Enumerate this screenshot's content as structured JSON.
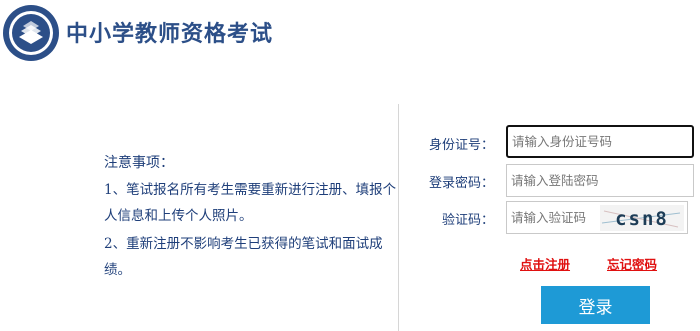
{
  "header": {
    "site_title": "中小学教师资格考试"
  },
  "notice": {
    "title": "注意事项：",
    "items": [
      "1、笔试报名所有考生需要重新进行注册、填报个人信息和上传个人照片。",
      "2、重新注册不影响考生已获得的笔试和面试成绩。"
    ]
  },
  "form": {
    "id_label": "身份证号：",
    "id_placeholder": "请输入身份证号码",
    "password_label": "登录密码：",
    "password_placeholder": "请输入登陆密码",
    "captcha_label": "验证码：",
    "captcha_placeholder": "请输入验证码",
    "captcha_text": "csn8",
    "register_link": "点击注册",
    "forgot_link": "忘记密码",
    "login_button": "登录"
  },
  "colors": {
    "title": "#2c4f88",
    "notice_text": "#1f3f7a",
    "link": "#e01010",
    "button": "#1e9ad6"
  }
}
